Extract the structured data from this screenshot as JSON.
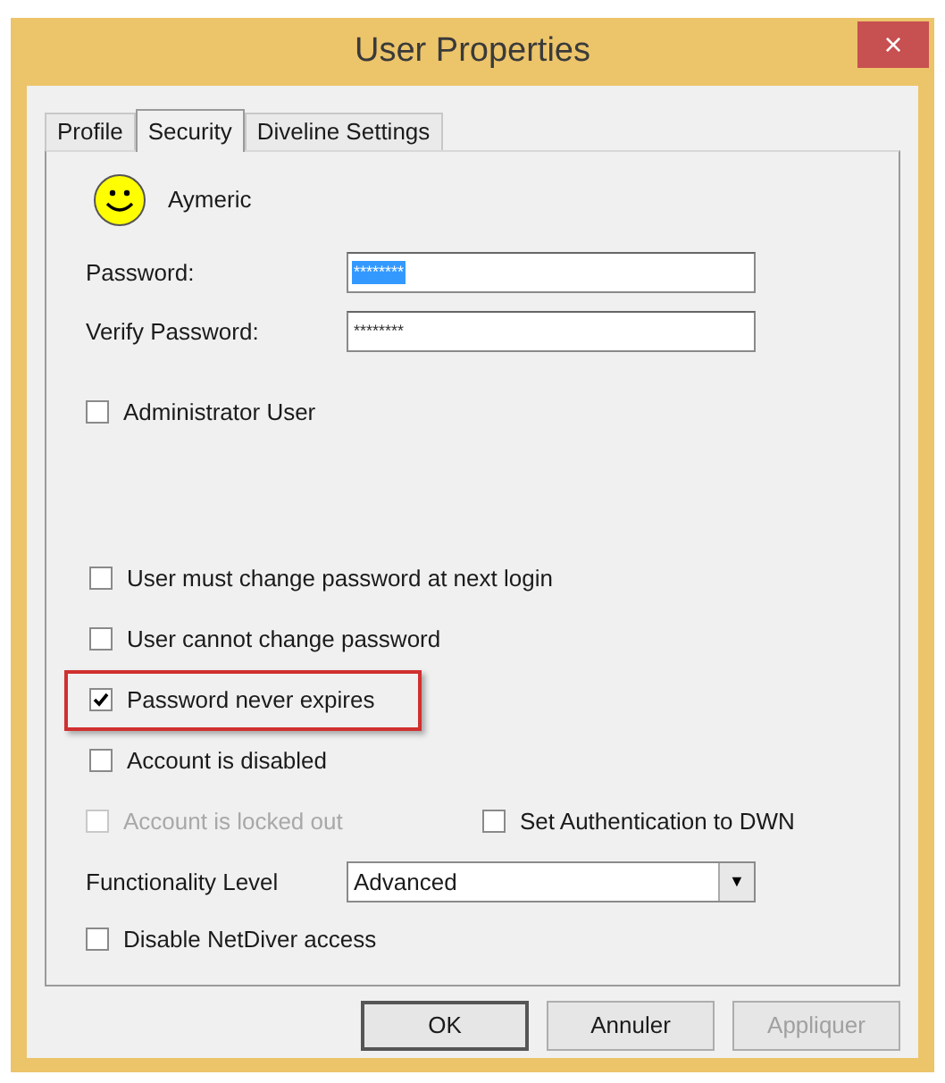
{
  "window": {
    "title": "User Properties",
    "close": "×"
  },
  "tabs": [
    {
      "label": "Profile",
      "selected": false
    },
    {
      "label": "Security",
      "selected": true
    },
    {
      "label": "Diveline Settings",
      "selected": false
    }
  ],
  "user": {
    "name": "Aymeric"
  },
  "fields": [
    {
      "label": "Password:",
      "value": "********",
      "selected": true
    },
    {
      "label": "Verify Password:",
      "value": "********",
      "selected": false
    }
  ],
  "admin": {
    "label": "Administrator User",
    "checked": false,
    "disabled": false
  },
  "account_options": [
    {
      "label": "User must change password at next login",
      "checked": false,
      "disabled": false,
      "highlighted": false
    },
    {
      "label": "User cannot change password",
      "checked": false,
      "disabled": false,
      "highlighted": false
    },
    {
      "label": "Password never expires",
      "checked": true,
      "disabled": false,
      "highlighted": true
    },
    {
      "label": "Account is disabled",
      "checked": false,
      "disabled": false,
      "highlighted": false
    }
  ],
  "pair_row": [
    {
      "label": "Account is locked out",
      "checked": false,
      "disabled": true
    },
    {
      "label": "Set Authentication to DWN",
      "checked": false,
      "disabled": false
    }
  ],
  "functionality": {
    "label": "Functionality Level",
    "value": "Advanced",
    "arrow": "▼"
  },
  "netdiver": {
    "label": "Disable NetDiver access",
    "checked": false,
    "disabled": false
  },
  "buttons": [
    {
      "label": "OK",
      "disabled": false,
      "default": true
    },
    {
      "label": "Annuler",
      "disabled": false,
      "default": false
    },
    {
      "label": "Appliquer",
      "disabled": true,
      "default": false
    }
  ]
}
